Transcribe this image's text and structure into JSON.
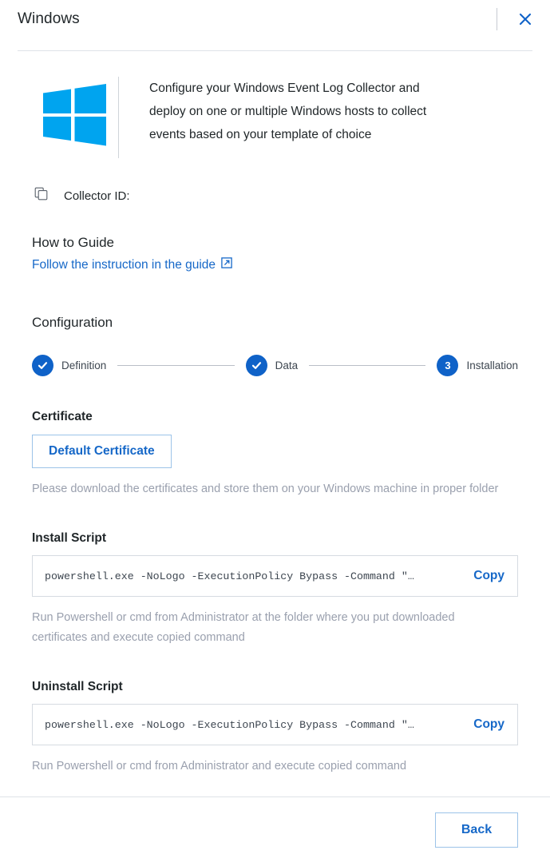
{
  "header": {
    "title": "Windows",
    "close_icon": "close-icon"
  },
  "intro": {
    "logo_icon": "windows-logo-icon",
    "description": "Configure your Windows Event Log Collector and deploy on one or multiple Windows hosts to collect events based on your template of choice"
  },
  "collector": {
    "copy_icon": "copy-icon",
    "label": "Collector ID:",
    "value": ""
  },
  "guide": {
    "heading": "How to Guide",
    "link_label": "Follow the instruction in the guide",
    "link_icon": "external-link-icon"
  },
  "configuration": {
    "heading": "Configuration",
    "steps": [
      {
        "marker": "✓",
        "label": "Definition",
        "state": "complete"
      },
      {
        "marker": "✓",
        "label": "Data",
        "state": "complete"
      },
      {
        "marker": "3",
        "label": "Installation",
        "state": "current"
      }
    ]
  },
  "certificate": {
    "heading": "Certificate",
    "button_label": "Default Certificate",
    "helper": "Please download the certificates and store them on your Windows machine in proper folder"
  },
  "install_script": {
    "heading": "Install Script",
    "command": "powershell.exe -NoLogo -ExecutionPolicy Bypass -Command \"…",
    "copy_label": "Copy",
    "helper": "Run Powershell or cmd from Administrator at the folder where you put downloaded certificates and execute copied command"
  },
  "uninstall_script": {
    "heading": "Uninstall Script",
    "command": "powershell.exe -NoLogo -ExecutionPolicy Bypass -Command \"…",
    "copy_label": "Copy",
    "helper": "Run Powershell or cmd from Administrator and execute copied command"
  },
  "footer": {
    "back_label": "Back"
  },
  "colors": {
    "link_blue": "#1668c8",
    "step_blue": "#0f62c8",
    "windows_cyan": "#00a4ef",
    "helper_grey": "#9aa0ae",
    "border_grey": "#d6dbe1"
  }
}
